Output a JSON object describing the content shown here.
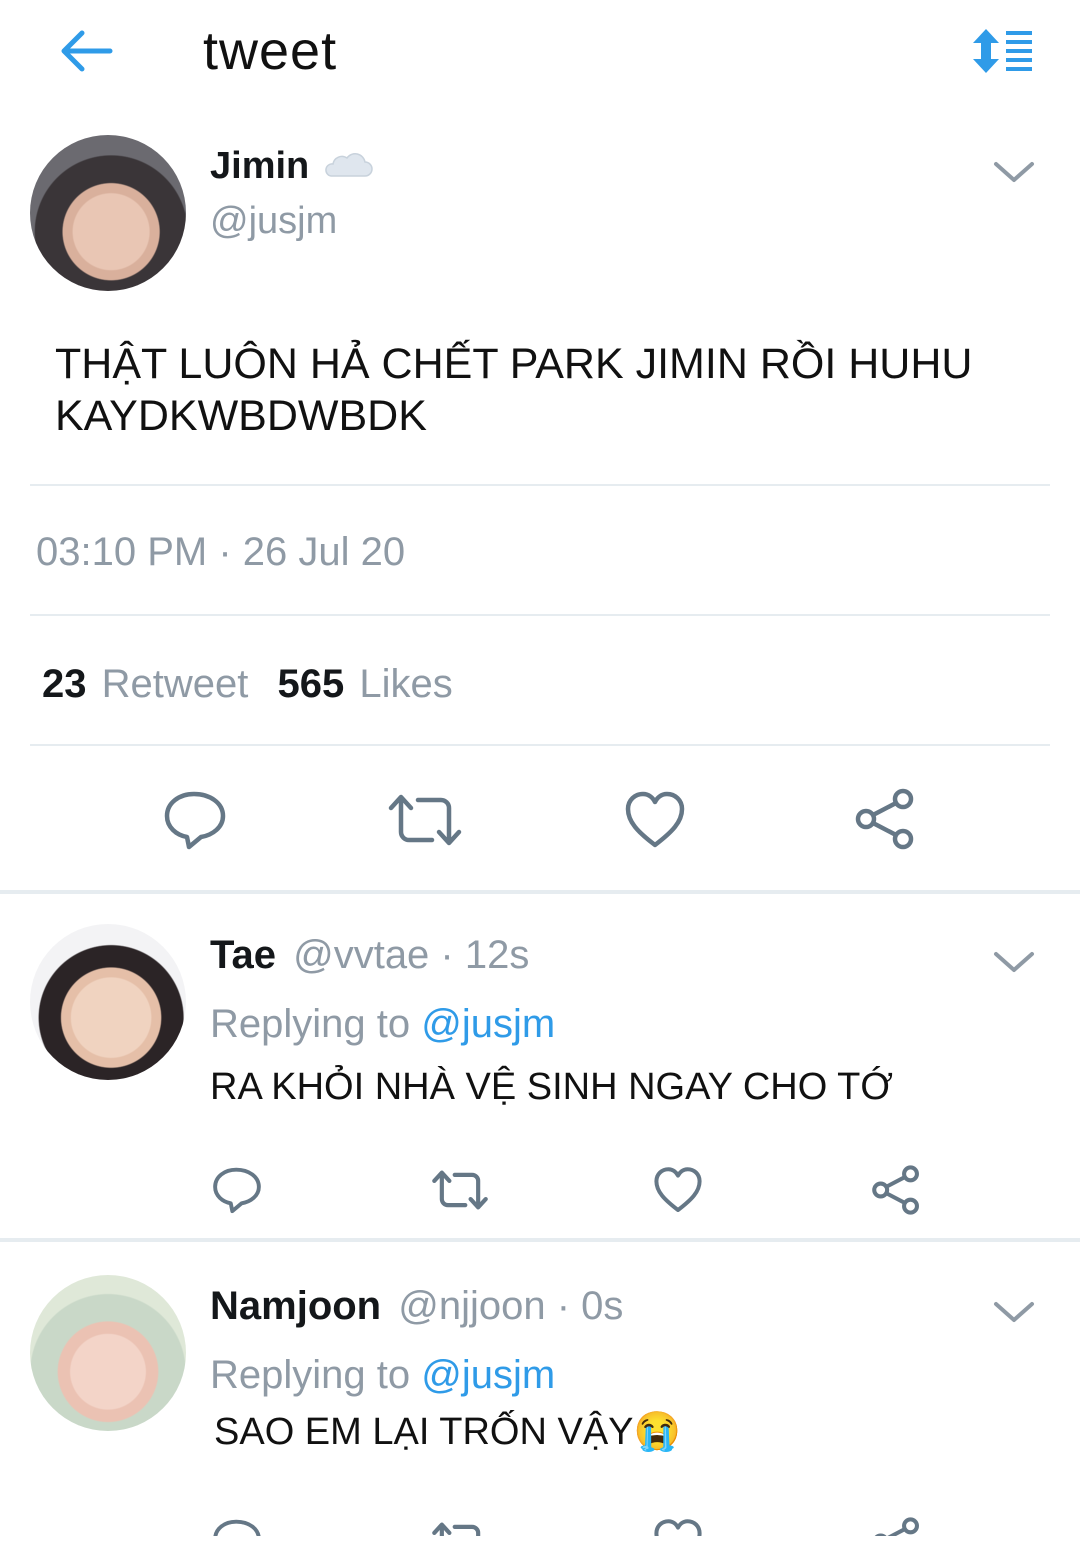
{
  "header": {
    "title": "tweet"
  },
  "tweet": {
    "name": "Jimin",
    "handle": "@jusjm",
    "text": "THẬT LUÔN HẢ CHẾT PARK JIMIN RỒI HUHU KAYDKWBDWBDK",
    "timestamp": "03:10 PM · 26 Jul 20",
    "retweets": "23",
    "retweet_label": "Retweet",
    "likes": "565",
    "likes_label": "Likes"
  },
  "replies": [
    {
      "name": "Tae",
      "meta": "@vvtae · 12s",
      "replying_prefix": "Replying to",
      "replying_to": "@jusjm",
      "text": "RA KHỎI NHÀ VỆ SINH NGAY CHO TỚ"
    },
    {
      "name": "Namjoon",
      "meta": "@njjoon · 0s",
      "replying_prefix": "Replying to",
      "replying_to": "@jusjm",
      "text": "SAO EM LẠI TRỐN VẬY😭"
    }
  ],
  "icons": {
    "back": "back-arrow-icon",
    "sort": "sort-list-icon",
    "chevron": "chevron-down-icon",
    "reply": "reply-icon",
    "retweet": "retweet-icon",
    "like": "heart-icon",
    "share": "share-icon",
    "name_badge": "cloud-icon"
  },
  "colors": {
    "accent": "#2f9be8",
    "muted": "#8f9aa5",
    "icon": "#657786",
    "divider": "#e6ecf0"
  }
}
